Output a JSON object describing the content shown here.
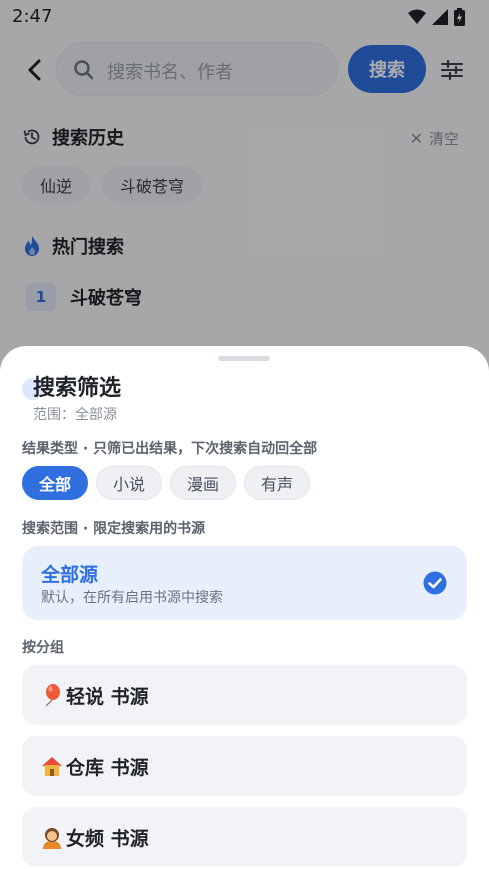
{
  "status_bar": {
    "time": "2:47"
  },
  "search": {
    "placeholder": "搜索书名、作者",
    "button_label": "搜索"
  },
  "history": {
    "title": "搜索历史",
    "clear_label": "清空",
    "items": [
      "仙逆",
      "斗破苍穹"
    ]
  },
  "hot": {
    "title": "热门搜索",
    "items": [
      {
        "rank": "1",
        "name": "斗破苍穹"
      }
    ]
  },
  "sheet": {
    "title": "搜索筛选",
    "subtitle": "范围：全部源",
    "result_type_label": "结果类型 · 只筛已出结果，下次搜索自动回全部",
    "types": [
      "全部",
      "小说",
      "漫画",
      "有声"
    ],
    "active_type_index": 0,
    "scope_label": "搜索范围 · 限定搜索用的书源",
    "scope": {
      "title": "全部源",
      "desc": "默认，在所有启用书源中搜索",
      "selected": true
    },
    "group_label": "按分组",
    "groups": [
      {
        "icon": "balloon-icon",
        "name": "轻说 书源"
      },
      {
        "icon": "house-icon",
        "name": "仓库 书源"
      },
      {
        "icon": "person-icon",
        "name": "女频 书源"
      }
    ]
  },
  "colors": {
    "accent": "#2f6fe0",
    "scope_bg": "#e8effc",
    "hot_icon": "#2f6fe0"
  }
}
